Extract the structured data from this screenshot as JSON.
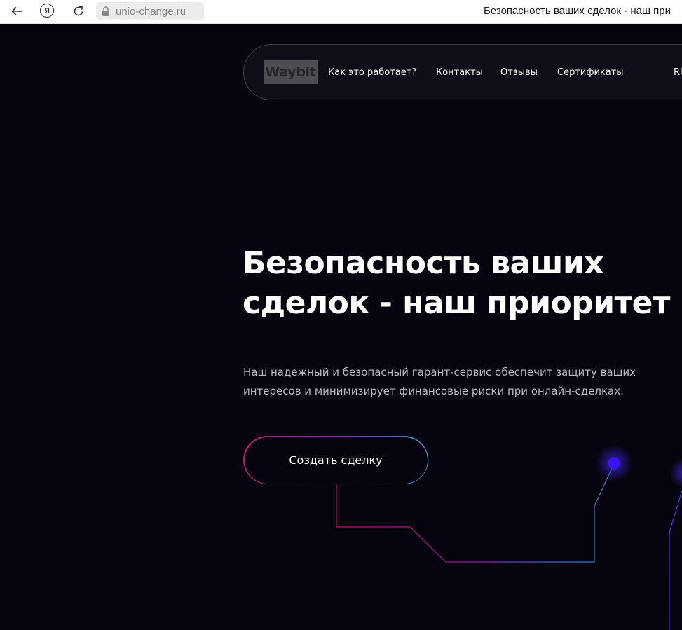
{
  "browser": {
    "url": "unio-change.ru",
    "tab_title": "Безопасность ваших сделок - наш при"
  },
  "header": {
    "logo": "Waybit",
    "nav": [
      {
        "label": "Как это работает?"
      },
      {
        "label": "Контакты"
      },
      {
        "label": "Отзывы"
      },
      {
        "label": "Сертификаты"
      }
    ],
    "lang": "RU"
  },
  "hero": {
    "title_line1": "Безопасность ваших",
    "title_line2": "сделок - наш приоритет",
    "subtitle_line1": "Наш надежный и безопасный гарант-сервис обеспечит защиту ваших",
    "subtitle_line2": "интересов и минимизирует финансовые риски при онлайн-сделках.",
    "cta_label": "Создать сделку"
  },
  "colors": {
    "background": "#06050f",
    "accent_pink": "#c0186c",
    "accent_blue": "#3f9ad4",
    "node_purple": "#3a12ff"
  },
  "icons": [
    "back-arrow-icon",
    "yandex-icon",
    "reload-icon",
    "lock-icon"
  ]
}
